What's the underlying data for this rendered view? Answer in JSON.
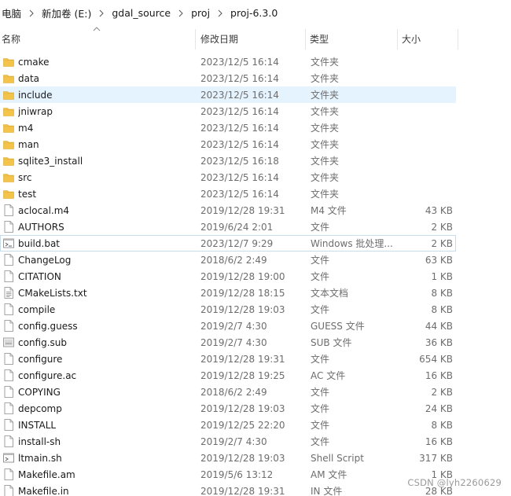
{
  "breadcrumb": [
    "电脑",
    "新加卷 (E:)",
    "gdal_source",
    "proj",
    "proj-6.3.0"
  ],
  "columns": {
    "name": "名称",
    "date": "修改日期",
    "type": "类型",
    "size": "大小"
  },
  "files": [
    {
      "name": "cmake",
      "date": "2023/12/5 16:14",
      "type": "文件夹",
      "size": "",
      "icon": "folder-icon"
    },
    {
      "name": "data",
      "date": "2023/12/5 16:14",
      "type": "文件夹",
      "size": "",
      "icon": "folder-icon"
    },
    {
      "name": "include",
      "date": "2023/12/5 16:14",
      "type": "文件夹",
      "size": "",
      "icon": "folder-icon"
    },
    {
      "name": "jniwrap",
      "date": "2023/12/5 16:14",
      "type": "文件夹",
      "size": "",
      "icon": "folder-icon"
    },
    {
      "name": "m4",
      "date": "2023/12/5 16:14",
      "type": "文件夹",
      "size": "",
      "icon": "folder-icon"
    },
    {
      "name": "man",
      "date": "2023/12/5 16:14",
      "type": "文件夹",
      "size": "",
      "icon": "folder-icon"
    },
    {
      "name": "sqlite3_install",
      "date": "2023/12/5 16:18",
      "type": "文件夹",
      "size": "",
      "icon": "folder-icon"
    },
    {
      "name": "src",
      "date": "2023/12/5 16:14",
      "type": "文件夹",
      "size": "",
      "icon": "folder-icon"
    },
    {
      "name": "test",
      "date": "2023/12/5 16:14",
      "type": "文件夹",
      "size": "",
      "icon": "folder-icon"
    },
    {
      "name": "aclocal.m4",
      "date": "2019/12/28 19:31",
      "type": "M4 文件",
      "size": "43 KB",
      "icon": "file-icon"
    },
    {
      "name": "AUTHORS",
      "date": "2019/6/24 2:01",
      "type": "文件",
      "size": "2 KB",
      "icon": "file-icon"
    },
    {
      "name": "build.bat",
      "date": "2023/12/7 9:29",
      "type": "Windows 批处理...",
      "size": "2 KB",
      "icon": "batch-file-icon"
    },
    {
      "name": "ChangeLog",
      "date": "2018/6/2 2:49",
      "type": "文件",
      "size": "63 KB",
      "icon": "file-icon"
    },
    {
      "name": "CITATION",
      "date": "2019/12/28 19:00",
      "type": "文件",
      "size": "1 KB",
      "icon": "file-icon"
    },
    {
      "name": "CMakeLists.txt",
      "date": "2019/12/28 18:15",
      "type": "文本文档",
      "size": "8 KB",
      "icon": "text-file-icon"
    },
    {
      "name": "compile",
      "date": "2019/12/28 19:03",
      "type": "文件",
      "size": "8 KB",
      "icon": "file-icon"
    },
    {
      "name": "config.guess",
      "date": "2019/2/7 4:30",
      "type": "GUESS 文件",
      "size": "44 KB",
      "icon": "file-icon"
    },
    {
      "name": "config.sub",
      "date": "2019/2/7 4:30",
      "type": "SUB 文件",
      "size": "36 KB",
      "icon": "sub-file-icon"
    },
    {
      "name": "configure",
      "date": "2019/12/28 19:31",
      "type": "文件",
      "size": "654 KB",
      "icon": "file-icon"
    },
    {
      "name": "configure.ac",
      "date": "2019/12/28 19:25",
      "type": "AC 文件",
      "size": "16 KB",
      "icon": "file-icon"
    },
    {
      "name": "COPYING",
      "date": "2018/6/2 2:49",
      "type": "文件",
      "size": "2 KB",
      "icon": "file-icon"
    },
    {
      "name": "depcomp",
      "date": "2019/12/28 19:03",
      "type": "文件",
      "size": "24 KB",
      "icon": "file-icon"
    },
    {
      "name": "INSTALL",
      "date": "2019/12/25 22:20",
      "type": "文件",
      "size": "8 KB",
      "icon": "file-icon"
    },
    {
      "name": "install-sh",
      "date": "2019/2/7 4:30",
      "type": "文件",
      "size": "16 KB",
      "icon": "file-icon"
    },
    {
      "name": "ltmain.sh",
      "date": "2019/12/28 19:03",
      "type": "Shell Script",
      "size": "317 KB",
      "icon": "script-file-icon"
    },
    {
      "name": "Makefile.am",
      "date": "2019/5/6 13:12",
      "type": "AM 文件",
      "size": "1 KB",
      "icon": "file-icon"
    },
    {
      "name": "Makefile.in",
      "date": "2019/12/28 19:31",
      "type": "IN 文件",
      "size": "28 KB",
      "icon": "file-icon"
    }
  ],
  "selected_index": 2,
  "focused_index": 11,
  "watermark": "CSDN @lyh2260629",
  "colors": {
    "folder": "#f4c34a",
    "selection": "#e5f3ff",
    "focus_border": "#c9dcea"
  }
}
